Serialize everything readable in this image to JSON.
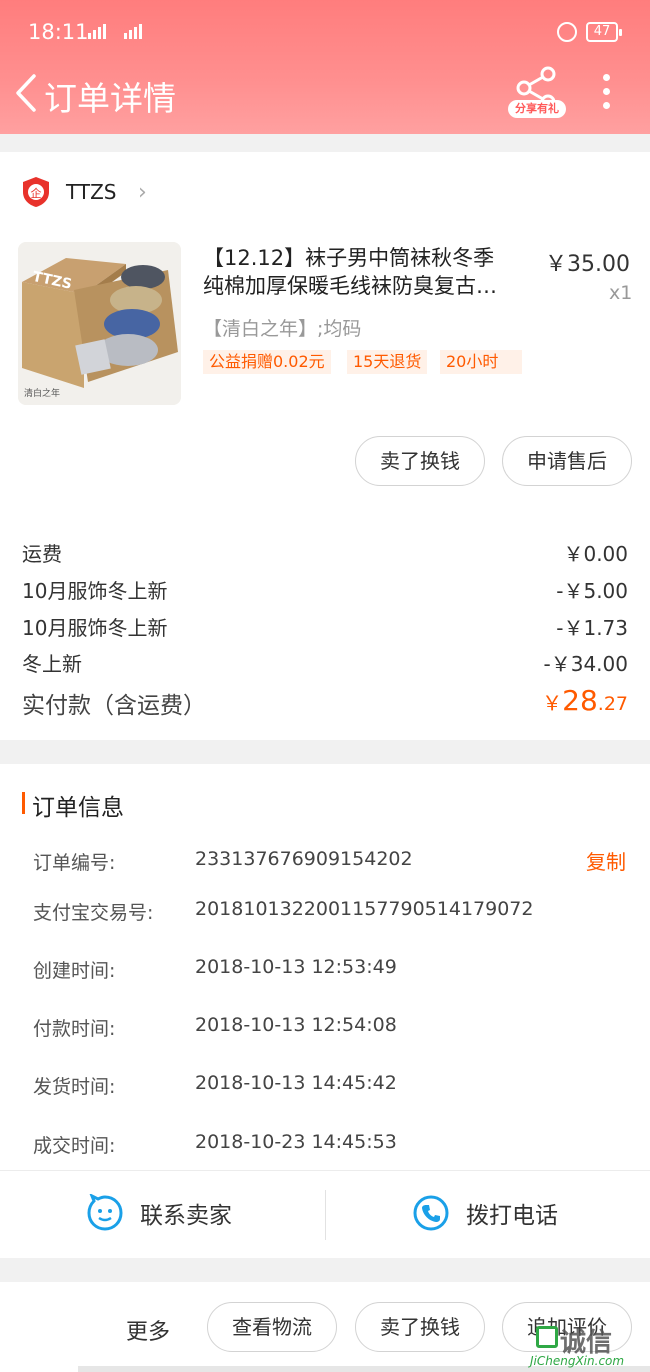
{
  "status_bar": {
    "time": "18:11",
    "sig1": "2G",
    "sig2": "4G",
    "battery": "47"
  },
  "nav": {
    "title": "订单详情",
    "share_label": "分享有礼"
  },
  "shop": {
    "badge": "企",
    "name": "TTZS"
  },
  "product": {
    "title_line1": "【12.12】袜子男中筒袜秋冬季",
    "title_line2": "纯棉加厚保暖毛线袜防臭复古…",
    "price": "￥35.00",
    "qty": "x1",
    "sku": "【清白之年】;均码",
    "tags": [
      "公益捐赠0.02元",
      "15天退货",
      "20小时"
    ],
    "thumb_box_text": "TTZS",
    "thumb_caption": "清白之年"
  },
  "item_actions": {
    "resell": "卖了换钱",
    "after_sale": "申请售后"
  },
  "fees": [
    {
      "label": "运费",
      "value": "￥0.00"
    },
    {
      "label": "10月服饰冬上新",
      "value": "-￥5.00"
    },
    {
      "label": "10月服饰冬上新",
      "value": "-￥1.73"
    },
    {
      "label": "冬上新",
      "value": "-￥34.00"
    }
  ],
  "paid": {
    "label": "实付款（含运费）",
    "currency": "￥",
    "integer": "28",
    "decimal": ".27"
  },
  "order_info": {
    "title": "订单信息",
    "copy": "复制",
    "rows": [
      {
        "key": "订单编号:",
        "value": "233137676909154202"
      },
      {
        "key": "支付宝交易号:",
        "value": "2018101322001157790514179072"
      },
      {
        "key": "创建时间:",
        "value": "2018-10-13 12:53:49"
      },
      {
        "key": "付款时间:",
        "value": "2018-10-13 12:54:08"
      },
      {
        "key": "发货时间:",
        "value": "2018-10-13 14:45:42"
      },
      {
        "key": "成交时间:",
        "value": "2018-10-23 14:45:53"
      }
    ]
  },
  "contact": {
    "seller": "联系卖家",
    "phone": "拨打电话"
  },
  "bottom_bar": {
    "more": "更多",
    "logistics": "查看物流",
    "resell": "卖了换钱",
    "review": "追加评价"
  },
  "watermark": {
    "text": "诚信",
    "url": "JiChengXin.com"
  },
  "colors": {
    "header": "#ff8888",
    "accent": "#ff5a00",
    "contact_icon": "#1aa0e8"
  }
}
